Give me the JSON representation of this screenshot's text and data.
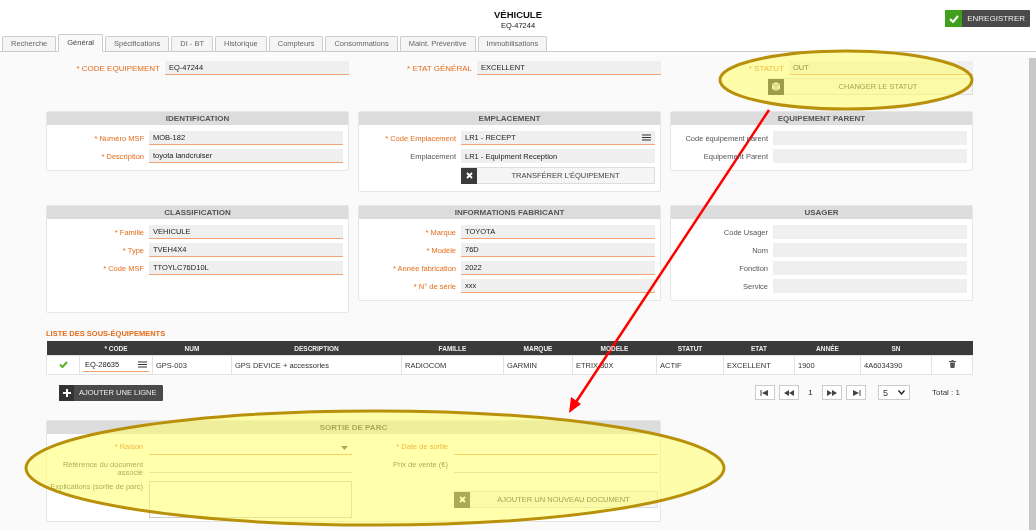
{
  "header": {
    "title": "VÉHICULE",
    "subtitle": "EQ-47244",
    "save_button": "ENREGISTRER"
  },
  "tabs": [
    {
      "label": "Recherche",
      "selected": false
    },
    {
      "label": "Général",
      "selected": true
    },
    {
      "label": "Spécifications",
      "selected": false
    },
    {
      "label": "DI - BT",
      "selected": false
    },
    {
      "label": "Historique",
      "selected": false
    },
    {
      "label": "Compteurs",
      "selected": false
    },
    {
      "label": "Consommations",
      "selected": false
    },
    {
      "label": "Maint. Préventive",
      "selected": false
    },
    {
      "label": "Immobilisations",
      "selected": false
    }
  ],
  "top_fields": [
    {
      "label": "* CODE EQUIPEMENT",
      "required": true,
      "kind": "text",
      "value": "EQ-47244"
    },
    {
      "label": "* ETAT GÉNÉRAL",
      "required": true,
      "kind": "text",
      "value": "EXCELLENT"
    },
    {
      "label": "* STATUT",
      "required": true,
      "kind": "text",
      "value": "OUT",
      "button": "CHANGER LE STATUT"
    }
  ],
  "panels": [
    {
      "title": "IDENTIFICATION",
      "fields": [
        {
          "label": "* Numéro MSF",
          "required": true,
          "kind": "text",
          "value": "MOB-182"
        },
        {
          "label": "* Description",
          "required": true,
          "kind": "text",
          "value": "toyota landcruiser"
        }
      ]
    },
    {
      "title": "EMPLACEMENT",
      "fields": [
        {
          "label": "* Code Emplacement",
          "required": true,
          "kind": "lookup",
          "value": "LR1 - RECEPT"
        },
        {
          "label": "Emplacement",
          "required": false,
          "kind": "text",
          "value": "LR1 - Equipment Reception"
        }
      ],
      "button": "TRANSFÉRER L’ÉQUIPEMENT"
    },
    {
      "title": "EQUIPEMENT PARENT",
      "fields": [
        {
          "label": "Code équipement parent",
          "required": false,
          "kind": "text"
        },
        {
          "label": "Equipement Parent",
          "required": false,
          "kind": "text"
        }
      ]
    },
    {
      "title": "CLASSIFICATION",
      "fields": [
        {
          "label": "* Famille",
          "required": true,
          "kind": "text",
          "value": "VEHICULE"
        },
        {
          "label": "* Type",
          "required": true,
          "kind": "text",
          "value": "TVEH4X4"
        },
        {
          "label": "* Code MSF",
          "required": true,
          "kind": "text",
          "value": "TTOYLC76D10L"
        }
      ]
    },
    {
      "title": "INFORMATIONS FABRICANT",
      "fields": [
        {
          "label": "* Marque",
          "required": true,
          "kind": "text",
          "value": "TOYOTA"
        },
        {
          "label": "* Modèle",
          "required": true,
          "kind": "text",
          "value": "76D"
        },
        {
          "label": "* Année fabrication",
          "required": true,
          "kind": "text",
          "value": "2022"
        },
        {
          "label": "* N° de série",
          "required": true,
          "kind": "text",
          "value": "xxx"
        }
      ]
    },
    {
      "title": "USAGER",
      "fields": [
        {
          "label": "Code Usager",
          "required": false,
          "kind": "text"
        },
        {
          "label": "Nom",
          "required": false,
          "kind": "text"
        },
        {
          "label": "Fonction",
          "required": false,
          "kind": "text"
        },
        {
          "label": "Service",
          "required": false,
          "kind": "text"
        }
      ]
    }
  ],
  "sub_equipment": {
    "title": "LISTE DES SOUS-ÉQUIPEMENTS",
    "columns": [
      "* CODE",
      "NUM",
      "DESCRIPTION",
      "FAMILLE",
      "MARQUE",
      "MODELE",
      "STATUT",
      "ETAT",
      "ANNÉE",
      "SN"
    ],
    "rows": [
      {
        "cells": [
          "EQ-28635",
          "GPS-003",
          "GPS DEVICE + accessories",
          "RADIOCOM",
          "GARMIN",
          "ETRIX 30X",
          "ACTIF",
          "EXCELLENT",
          "1900",
          "4A6034390"
        ]
      }
    ],
    "add_button": "AJOUTER UNE LIGNE",
    "pagination": {
      "page": "1",
      "page_size": "5",
      "total": "Total : 1"
    }
  },
  "exit_panel": {
    "title": "SORTIE DE PARC",
    "fields": [
      {
        "label": "* Raison",
        "required": true,
        "kind": "select"
      },
      {
        "label": "* Date de sortie",
        "required": true,
        "kind": "line"
      },
      {
        "label": "Référence du document associé",
        "required": false,
        "kind": "line"
      },
      {
        "label": "Prix de vente (€)",
        "required": false,
        "kind": "line"
      },
      {
        "label": "Explications (sortie de parc)",
        "required": false,
        "kind": "textarea"
      }
    ],
    "button": "AJOUTER UN NOUVEAU DOCUMENT"
  }
}
